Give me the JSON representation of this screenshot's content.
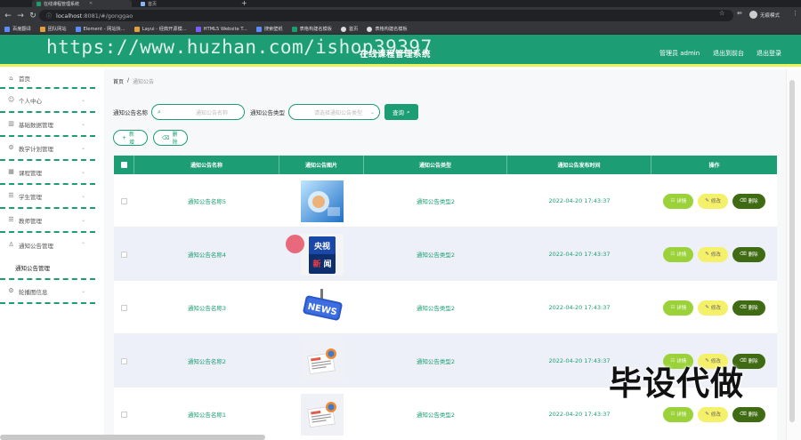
{
  "browser": {
    "tabs": [
      {
        "title": "在线课程管理系统"
      },
      {
        "title": "首页"
      }
    ],
    "url_host": "localhost",
    "url_path": ":8081/#/gonggao",
    "profile": "无痕模式",
    "bookmarks": [
      "百度翻译",
      "团队网站",
      "Element - 网站快...",
      "Layui - 经典开源模...",
      "HTML5 Website T...",
      "搜索壁纸",
      "表格构建名模板",
      "首页",
      "表格构建名模板"
    ]
  },
  "header": {
    "title": "在线课程管理系统",
    "admin": "管理员 admin",
    "backstage": "退出到前台",
    "logout": "退出登录"
  },
  "watermarks": {
    "url": "https://www.huzhan.com/ishop39397",
    "corner": "毕设代做"
  },
  "sidebar": {
    "items": [
      {
        "label": "首页",
        "icon": "home-icon"
      },
      {
        "label": "个人中心",
        "icon": "user-icon"
      },
      {
        "label": "基础数据管理",
        "icon": "chart-icon"
      },
      {
        "label": "教学计划管理",
        "icon": "settings-icon"
      },
      {
        "label": "课程管理",
        "icon": "grid-icon"
      },
      {
        "label": "学生管理",
        "icon": "list-icon"
      },
      {
        "label": "教师管理",
        "icon": "list-icon"
      },
      {
        "label": "通知公告管理",
        "icon": "person-icon"
      },
      {
        "label": "轮播图信息",
        "icon": "settings-icon"
      }
    ],
    "sub_item": "通知公告管理"
  },
  "breadcrumb": {
    "home": "首页",
    "sep": "/",
    "current": "通知公告"
  },
  "search": {
    "name_label": "通知公告名称",
    "name_placeholder": "通知公告名称",
    "type_label": "通知公告类型",
    "type_placeholder": "请选择通知公告类型",
    "query": "查询"
  },
  "actions": {
    "add": "新增",
    "delete": "删除"
  },
  "table": {
    "headers": [
      "通知公告名称",
      "通知公告图片",
      "通知公告类型",
      "通知公告发布时间",
      "操作"
    ],
    "rows": [
      {
        "name": "通知公告名称5",
        "type": "通知公告类型2",
        "time": "2022-04-20 17:43:37",
        "img": "tech-image"
      },
      {
        "name": "通知公告名称4",
        "type": "通知公告类型2",
        "time": "2022-04-20 17:43:37",
        "img": "cctv-news-image"
      },
      {
        "name": "通知公告名称3",
        "type": "通知公告类型2",
        "time": "2022-04-20 17:43:37",
        "img": "news-sign-image"
      },
      {
        "name": "通知公告名称2",
        "type": "通知公告类型2",
        "time": "2022-04-20 17:43:37",
        "img": "newspaper-image"
      },
      {
        "name": "通知公告名称1",
        "type": "通知公告类型2",
        "time": "2022-04-20 17:43:37",
        "img": "newspaper-image"
      }
    ],
    "buttons": {
      "detail": "详情",
      "edit": "修改",
      "delete": "删除"
    }
  },
  "colors": {
    "primary": "#1c9d73",
    "detail": "#9bd23a",
    "edit": "#f4f06a",
    "delete": "#3f6b12"
  }
}
